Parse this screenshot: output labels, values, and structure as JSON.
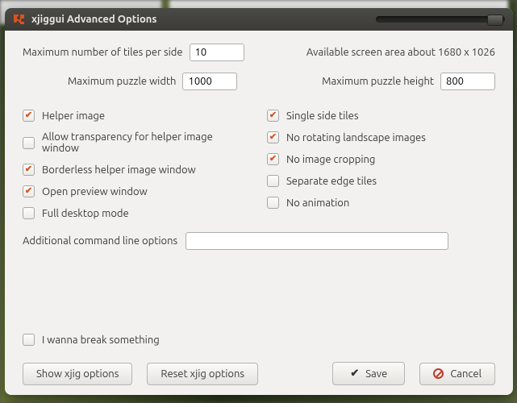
{
  "title": "xjiggui Advanced Options",
  "top": {
    "max_tiles_label": "Maximum number of tiles per side",
    "max_tiles_value": "10",
    "screen_info": "Available screen area about 1680 x 1026",
    "max_width_label": "Maximum puzzle width",
    "max_width_value": "1000",
    "max_height_label": "Maximum puzzle height",
    "max_height_value": "800"
  },
  "left_checks": [
    {
      "label": "Helper image",
      "checked": true
    },
    {
      "label": "Allow transparency for helper image window",
      "checked": false
    },
    {
      "label": "Borderless helper image window",
      "checked": true
    },
    {
      "label": "Open preview window",
      "checked": true
    },
    {
      "label": "Full desktop mode",
      "checked": false
    }
  ],
  "right_checks": [
    {
      "label": "Single side tiles",
      "checked": true
    },
    {
      "label": "No rotating landscape images",
      "checked": true
    },
    {
      "label": "No image cropping",
      "checked": true
    },
    {
      "label": "Separate edge tiles",
      "checked": false
    },
    {
      "label": "No animation",
      "checked": false
    }
  ],
  "cmd": {
    "label": "Additional command line options",
    "value": ""
  },
  "break_check": {
    "label": "I wanna break something",
    "checked": false
  },
  "buttons": {
    "show": "Show xjig options",
    "reset": "Reset xjig options",
    "save": "Save",
    "cancel": "Cancel"
  }
}
